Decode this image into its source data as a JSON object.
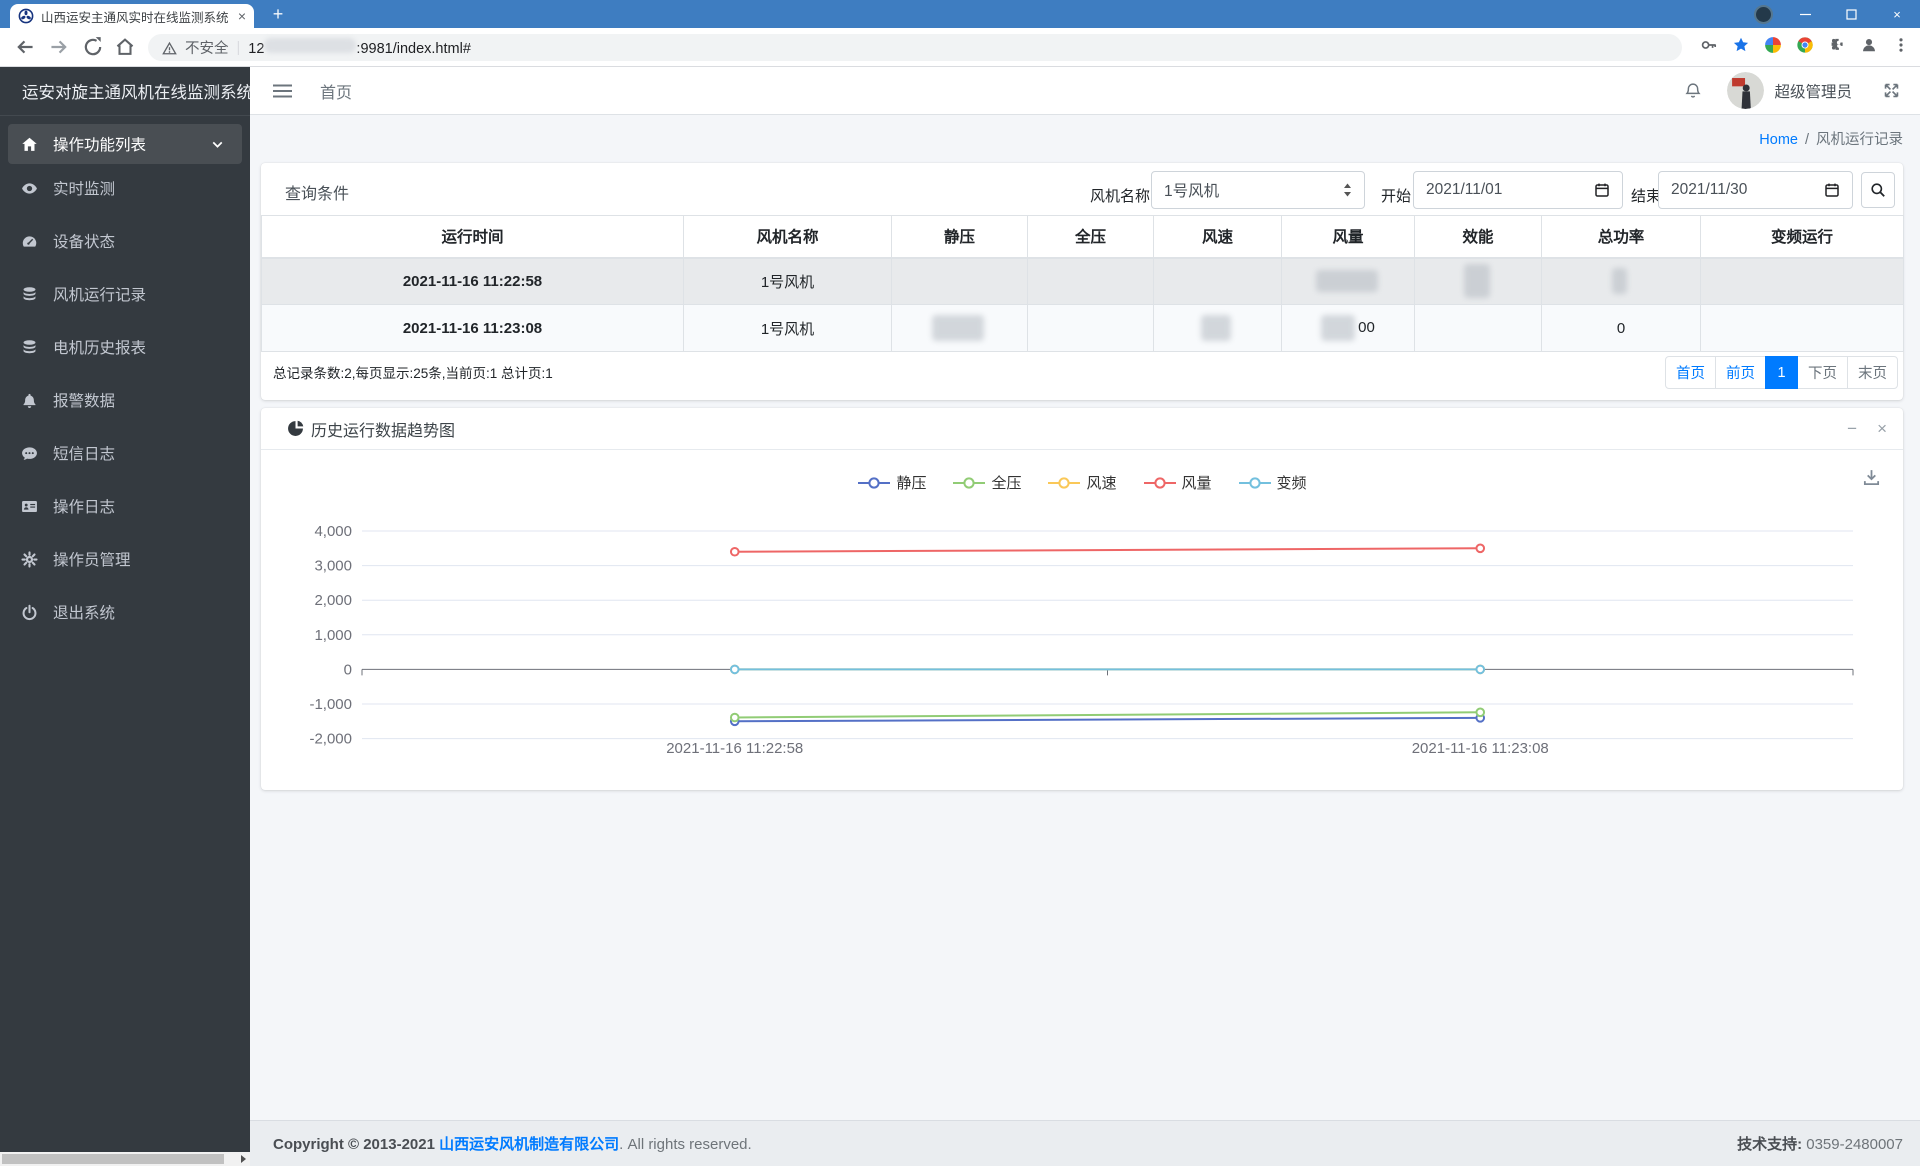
{
  "browser": {
    "tab_title": "山西运安主通风实时在线监测系统",
    "security_label": "不安全",
    "url_prefix": "12",
    "url_suffix": ":9981/index.html#"
  },
  "sidebar": {
    "brand": "运安对旋主通风机在线监测系统",
    "parent_label": "操作功能列表",
    "items": [
      {
        "label": "实时监测",
        "icon": "eye-icon"
      },
      {
        "label": "设备状态",
        "icon": "gauge-icon"
      },
      {
        "label": "风机运行记录",
        "icon": "database-icon"
      },
      {
        "label": "电机历史报表",
        "icon": "database-icon"
      },
      {
        "label": "报警数据",
        "icon": "bell-icon"
      },
      {
        "label": "短信日志",
        "icon": "comment-icon"
      },
      {
        "label": "操作日志",
        "icon": "idcard-icon"
      },
      {
        "label": "操作员管理",
        "icon": "gear-icon"
      },
      {
        "label": "退出系统",
        "icon": "power-icon"
      }
    ]
  },
  "topnav": {
    "home_link": "首页",
    "username": "超级管理员"
  },
  "breadcrumb": {
    "home": "Home",
    "sep": "/",
    "current": "风机运行记录"
  },
  "query": {
    "title": "查询条件",
    "fan_label": "风机名称",
    "fan_value": "1号风机",
    "start_label": "开始",
    "start_value": "2021/11/01",
    "end_label": "结束",
    "end_value": "2021/11/30"
  },
  "table": {
    "columns": [
      "运行时间",
      "风机名称",
      "静压",
      "全压",
      "风速",
      "风量",
      "效能",
      "总功率",
      "变频运行"
    ],
    "rows": [
      {
        "cells": [
          {
            "t": "2021-11-16 11:22:58"
          },
          {
            "t": "1号风机"
          },
          {
            "t": ""
          },
          {
            "t": ""
          },
          {
            "t": ""
          },
          {
            "t": "",
            "redacted": true,
            "rw": 62,
            "rh": 22
          },
          {
            "t": "",
            "redacted": true,
            "rw": 26,
            "rh": 34
          },
          {
            "t": "",
            "redacted": true,
            "rw": 15,
            "rh": 26
          },
          {
            "t": ""
          }
        ]
      },
      {
        "cells": [
          {
            "t": "2021-11-16 11:23:08"
          },
          {
            "t": "1号风机"
          },
          {
            "t": "",
            "redacted": true,
            "rw": 52,
            "rh": 26
          },
          {
            "t": ""
          },
          {
            "t": "",
            "redacted": true,
            "rw": 30,
            "rh": 26
          },
          {
            "t": "00",
            "redacted": true,
            "rw": 34,
            "rh": 26
          },
          {
            "t": ""
          },
          {
            "t": "0"
          },
          {
            "t": ""
          }
        ]
      }
    ]
  },
  "pager": {
    "summary": "总记录条数:2,每页显示:25条,当前页:1 总计页:1",
    "buttons": [
      {
        "label": "首页",
        "state": "link"
      },
      {
        "label": "前页",
        "state": "link"
      },
      {
        "label": "1",
        "state": "active"
      },
      {
        "label": "下页",
        "state": "disabled"
      },
      {
        "label": "末页",
        "state": "disabled"
      }
    ]
  },
  "chart_panel": {
    "title": "历史运行数据趋势图"
  },
  "chart_data": {
    "type": "line",
    "title": "历史运行数据趋势图",
    "x": [
      "2021-11-16 11:22:58",
      "2021-11-16 11:23:08"
    ],
    "series": [
      {
        "name": "静压",
        "color": "#5470c6",
        "values": [
          -1500,
          -1400
        ]
      },
      {
        "name": "全压",
        "color": "#91cc75",
        "values": [
          -1390,
          -1240
        ]
      },
      {
        "name": "风速",
        "color": "#fac858",
        "values": [
          0,
          0
        ]
      },
      {
        "name": "风量",
        "color": "#ee6666",
        "values": [
          3400,
          3500
        ]
      },
      {
        "name": "变频",
        "color": "#73c0de",
        "values": [
          0,
          0
        ]
      }
    ],
    "ylim": [
      -2000,
      4000
    ],
    "ytick_step": 1000,
    "grid": true,
    "legend_position": "top-center",
    "marker": "hollow-circle"
  },
  "footer": {
    "copyright_prefix": "Copyright © 2013-2021 ",
    "company": "山西运安风机制造有限公司",
    "copyright_suffix": ". All rights reserved.",
    "support_label": "技术支持:",
    "support_value": "0359-2480007"
  },
  "colors": {
    "accent": "#007bff",
    "tabbar_bg": "#3e7dc1",
    "sidebar_bg": "#343a40",
    "content_bg": "#f4f6f9",
    "axis": "#6E7079",
    "gridline": "#E0E6F1"
  }
}
